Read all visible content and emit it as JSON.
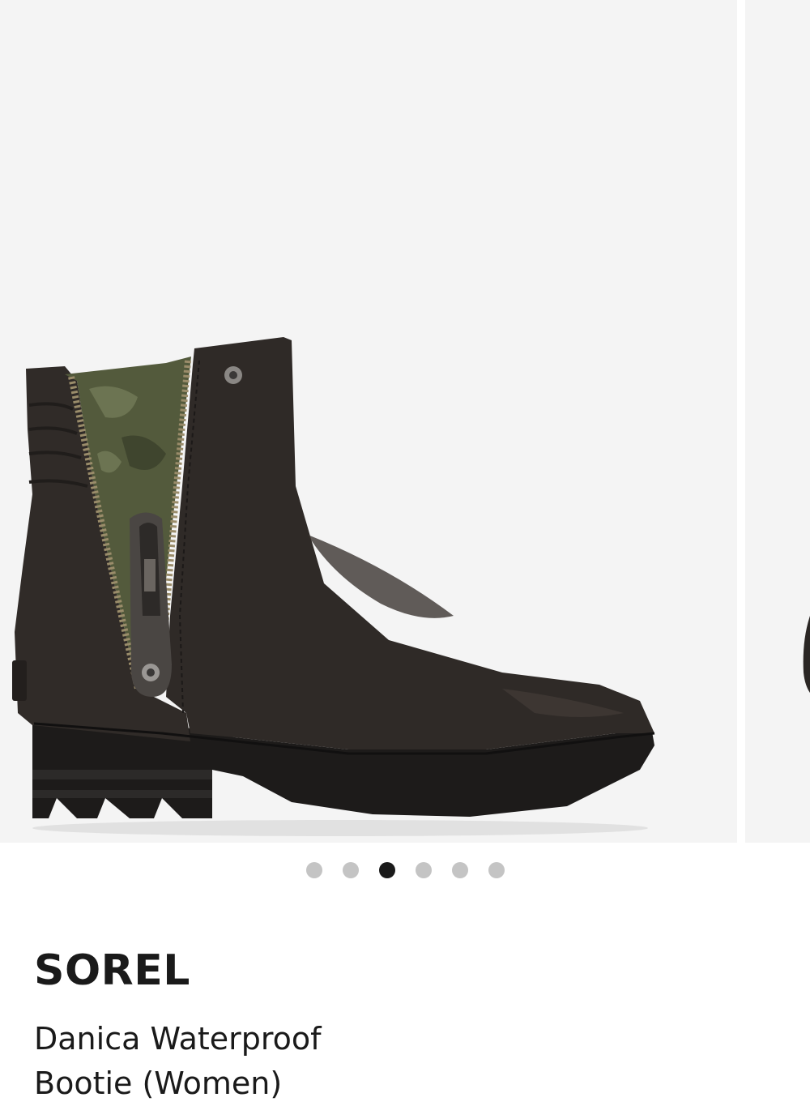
{
  "product": {
    "brand": "SOREL",
    "name": "Danica Waterproof Bootie (Women)"
  },
  "carousel": {
    "total_images": 6,
    "active_index": 2,
    "dot_color": "#c4c4c4",
    "active_dot_color": "#1a1a1a",
    "image_background": "#f4f4f4"
  },
  "icons": {
    "main_image": "black-leather-ankle-boot-image",
    "next_image": "boot-image-peek"
  },
  "colors": {
    "text": "#1a1a1a",
    "boot_leather": "#2a2624",
    "zipper_lining": "#5a6340"
  }
}
